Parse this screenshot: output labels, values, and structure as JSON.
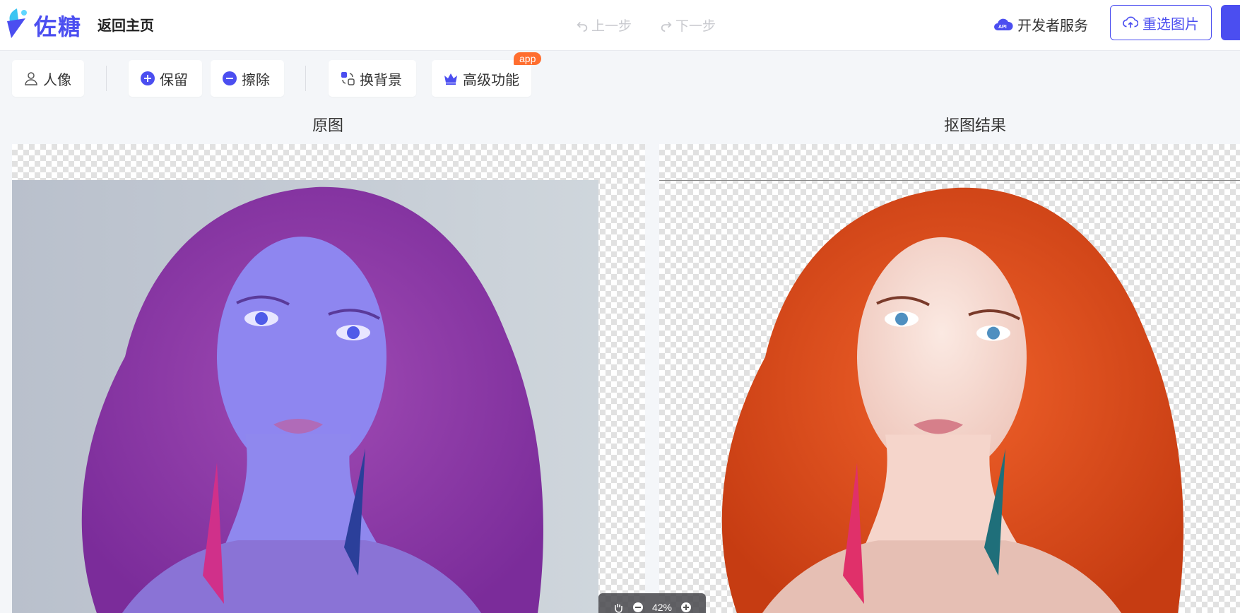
{
  "header": {
    "brand": "佐糖",
    "back_home": "返回主页",
    "undo_label": "上一步",
    "redo_label": "下一步",
    "dev_service": "开发者服务",
    "api_badge": "API",
    "reselect_label": "重选图片"
  },
  "toolbar": {
    "portrait": "人像",
    "keep": "保留",
    "erase": "擦除",
    "change_bg": "换背景",
    "advanced": "高级功能",
    "app_badge": "app"
  },
  "panels": {
    "original_title": "原图",
    "result_title": "抠图结果"
  },
  "zoom": {
    "level": "42%"
  },
  "colors": {
    "accent": "#4b4ef0",
    "badge": "#ff6e2f"
  }
}
